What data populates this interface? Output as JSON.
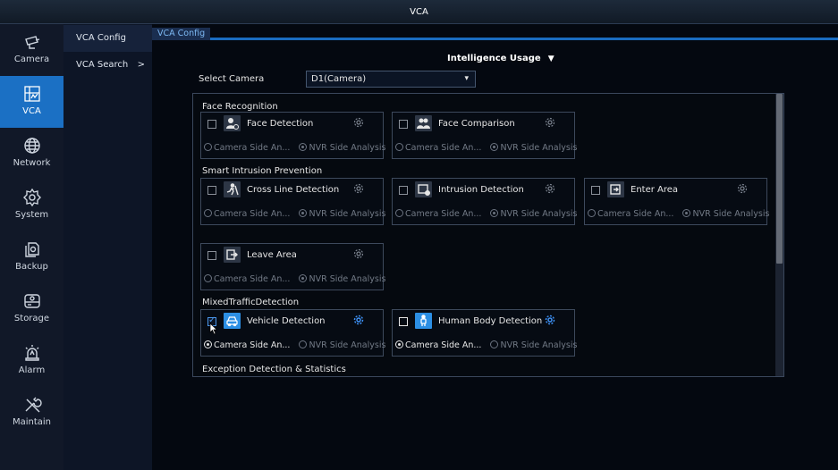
{
  "window": {
    "title": "VCA"
  },
  "nav": {
    "items": [
      {
        "label": "Camera",
        "icon": "camera-icon"
      },
      {
        "label": "VCA",
        "icon": "vca-icon",
        "active": true
      },
      {
        "label": "Network",
        "icon": "network-globe-icon"
      },
      {
        "label": "System",
        "icon": "system-gear-icon"
      },
      {
        "label": "Backup",
        "icon": "backup-icon"
      },
      {
        "label": "Storage",
        "icon": "storage-disk-icon"
      },
      {
        "label": "Alarm",
        "icon": "alarm-siren-icon"
      },
      {
        "label": "Maintain",
        "icon": "maintain-tools-icon"
      }
    ]
  },
  "subnav": {
    "items": [
      {
        "label": "VCA Config",
        "active": true
      },
      {
        "label": "VCA Search",
        "arrow": ">"
      }
    ]
  },
  "tabs": [
    {
      "label": "VCA Config",
      "active": true
    }
  ],
  "usage": {
    "title": "Intelligence Usage",
    "chevron": "▼"
  },
  "camera_select": {
    "label": "Select Camera",
    "value": "D1(Camera)",
    "caret": "▾"
  },
  "sections": [
    {
      "title": "Face Recognition"
    },
    {
      "title": "Smart Intrusion Prevention"
    },
    {
      "title": "MixedTrafficDetection"
    },
    {
      "title": "Exception Detection & Statistics"
    }
  ],
  "functions": {
    "face_detection": {
      "title": "Face Detection",
      "option_camera": "Camera Side An...",
      "option_nvr": "NVR Side Analysis",
      "checked": false,
      "selected": "nvr"
    },
    "face_comparison": {
      "title": "Face Comparison",
      "option_camera": "Camera Side An...",
      "option_nvr": "NVR Side Analysis",
      "checked": false,
      "selected": "nvr"
    },
    "cross_line": {
      "title": "Cross Line Detection",
      "option_camera": "Camera Side An...",
      "option_nvr": "NVR Side Analysis",
      "checked": false,
      "selected": "nvr"
    },
    "intrusion": {
      "title": "Intrusion Detection",
      "option_camera": "Camera Side An...",
      "option_nvr": "NVR Side Analysis",
      "checked": false,
      "selected": "nvr"
    },
    "enter_area": {
      "title": "Enter Area",
      "option_camera": "Camera Side An...",
      "option_nvr": "NVR Side Analysis",
      "checked": false,
      "selected": "nvr"
    },
    "leave_area": {
      "title": "Leave Area",
      "option_camera": "Camera Side An...",
      "option_nvr": "NVR Side Analysis",
      "checked": false,
      "selected": "nvr"
    },
    "vehicle": {
      "title": "Vehicle Detection",
      "option_camera": "Camera Side An...",
      "option_nvr": "NVR Side Analysis",
      "checked": true,
      "selected": "camera"
    },
    "human_body": {
      "title": "Human Body Detection",
      "option_camera": "Camera Side An...",
      "option_nvr": "NVR Side Analysis",
      "checked": false,
      "selected": "camera"
    }
  },
  "colors": {
    "accent": "#1b70c4",
    "icon_blue": "#2c8fe4",
    "gear_active": "#3d8ef0"
  }
}
